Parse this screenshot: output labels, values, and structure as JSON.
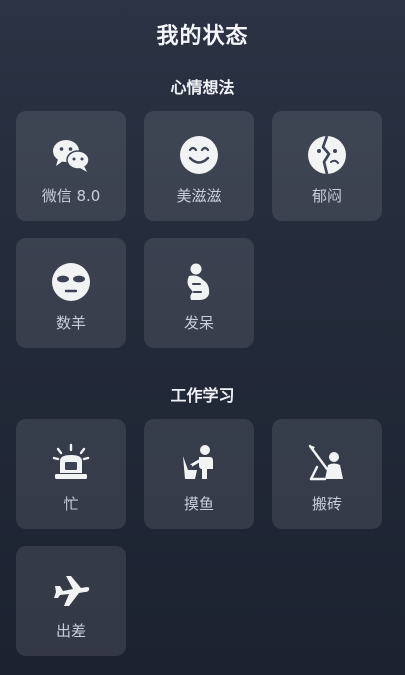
{
  "page": {
    "title": "我的状态"
  },
  "sections": [
    {
      "title": "心情想法",
      "items": [
        {
          "label": "微信 8.0",
          "icon": "wechat-icon"
        },
        {
          "label": "美滋滋",
          "icon": "smiley-face-icon"
        },
        {
          "label": "郁闷",
          "icon": "broken-heart-face-icon"
        },
        {
          "label": "数羊",
          "icon": "sleep-mask-face-icon"
        },
        {
          "label": "发呆",
          "icon": "crouching-person-icon"
        }
      ]
    },
    {
      "title": "工作学习",
      "items": [
        {
          "label": "忙",
          "icon": "alarm-laptop-icon"
        },
        {
          "label": "摸鱼",
          "icon": "sitting-person-icon"
        },
        {
          "label": "搬砖",
          "icon": "shovel-worker-icon"
        },
        {
          "label": "出差",
          "icon": "airplane-icon"
        }
      ]
    }
  ],
  "colors": {
    "background_top": "#2b3344",
    "background_bottom": "#1c2230",
    "tile": "rgba(255,255,255,0.10)",
    "label": "#c9ced8",
    "icon": "#f2f3f5"
  }
}
